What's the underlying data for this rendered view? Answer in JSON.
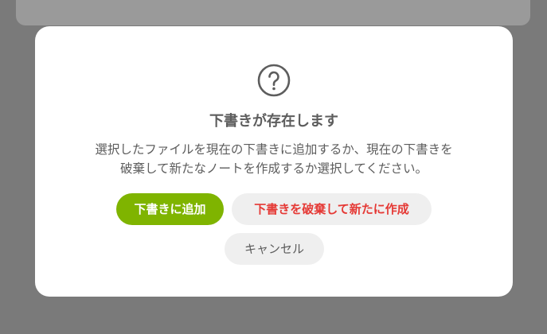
{
  "dialog": {
    "icon": "question-circle-icon",
    "title": "下書きが存在します",
    "message_line1": "選択したファイルを現在の下書きに追加するか、現在の下書きを",
    "message_line2": "破棄して新たなノートを作成するか選択してください。",
    "buttons": {
      "add_label": "下書きに追加",
      "discard_label": "下書きを破棄して新たに作成",
      "cancel_label": "キャンセル"
    }
  },
  "colors": {
    "overlay": "#7a7a7a",
    "accent_green": "#7fb400",
    "danger_red": "#e53935",
    "text_gray": "#5d5d5d",
    "secondary_button_bg": "#efefef"
  }
}
